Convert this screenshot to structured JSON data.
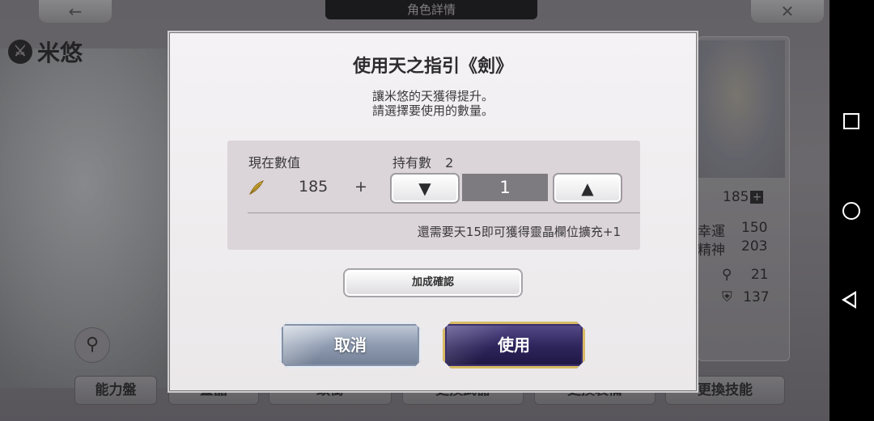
{
  "background": {
    "top_tab_title": "角色詳情",
    "back_icon": "←",
    "close_icon": "✕",
    "character_name": "米悠",
    "stats": {
      "star_value": "185",
      "luck_label": "幸運",
      "luck_value": "150",
      "spirit_label": "精神",
      "spirit_value": "203",
      "stat_a_value": "21",
      "stat_b_value": "137"
    },
    "bottom_buttons": [
      "能力盤",
      "靈晶",
      "頭銜",
      "更換武器",
      "更換裝備",
      "更換技能"
    ]
  },
  "dialog": {
    "title": "使用天之指引《劍》",
    "description_line1": "讓米悠的天獲得提升。",
    "description_line2": "請選擇要使用的數量。",
    "current_value_label": "現在數值",
    "current_value": "185",
    "plus_sign": "+",
    "owned_label": "持有數",
    "owned_count": "2",
    "decrement_icon": "▼",
    "increment_icon": "▲",
    "quantity": "1",
    "hint": "還需要天15即可獲得靈晶欄位擴充+1",
    "confirm_bonus_label": "加成確認",
    "cancel_label": "取消",
    "use_label": "使用"
  },
  "colors": {
    "dialog_bg": "#f2f0f2",
    "panel_bg": "#dbd4d9",
    "quantity_bg": "#7e7b80",
    "use_button": "#2d245a",
    "use_button_border": "#d8bb63",
    "cancel_button": "#8e9bb0",
    "feather_icon": "#d9b43a"
  }
}
